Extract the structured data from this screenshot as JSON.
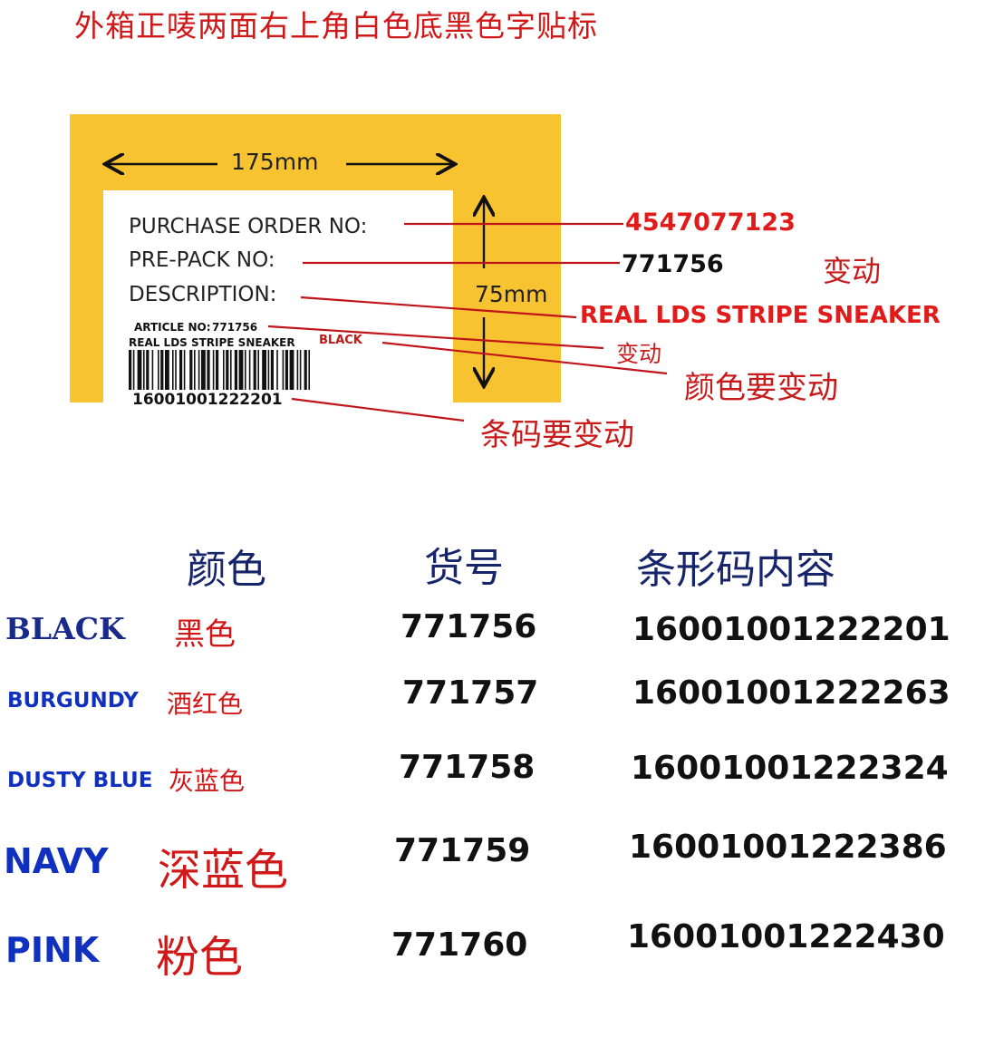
{
  "title": "外箱正唛两面右上角白色底黑色字贴标",
  "label": {
    "width_dim": "175mm",
    "height_dim": "75mm",
    "purchase_order_label": "PURCHASE ORDER NO:",
    "prepack_label": "PRE-PACK NO:",
    "description_label": "DESCRIPTION:",
    "article_label": "ARTICLE NO:",
    "article_value": "771756",
    "product_line": "REAL LDS STRIPE SNEAKER",
    "color_tag": "BLACK",
    "barcode_number": "16001001222201"
  },
  "callouts": {
    "po_value": "4547077123",
    "prepack_value": "771756",
    "prepack_note": "变动",
    "description_value": "REAL LDS STRIPE SNEAKER",
    "article_note": "变动",
    "color_note": "颜色要变动",
    "barcode_note": "条码要变动"
  },
  "table": {
    "headers": [
      "颜色",
      "货号",
      "条形码内容"
    ],
    "rows": [
      {
        "color_en": "BLACK",
        "color_zh": "黑色",
        "article": "771756",
        "barcode": "16001001222201"
      },
      {
        "color_en": "BURGUNDY",
        "color_zh": "酒红色",
        "article": "771757",
        "barcode": "16001001222263"
      },
      {
        "color_en": "DUSTY BLUE",
        "color_zh": "灰蓝色",
        "article": "771758",
        "barcode": "16001001222324"
      },
      {
        "color_en": "NAVY",
        "color_zh": "深蓝色",
        "article": "771759",
        "barcode": "16001001222386"
      },
      {
        "color_en": "PINK",
        "color_zh": "粉色",
        "article": "771760",
        "barcode": "16001001222430"
      }
    ]
  },
  "colors": {
    "label_border": "#f7c331",
    "callout_line": "#c0141a",
    "title_red": "#d01818",
    "header_navy": "#16246b",
    "color_name_blue": "#1030c0"
  }
}
